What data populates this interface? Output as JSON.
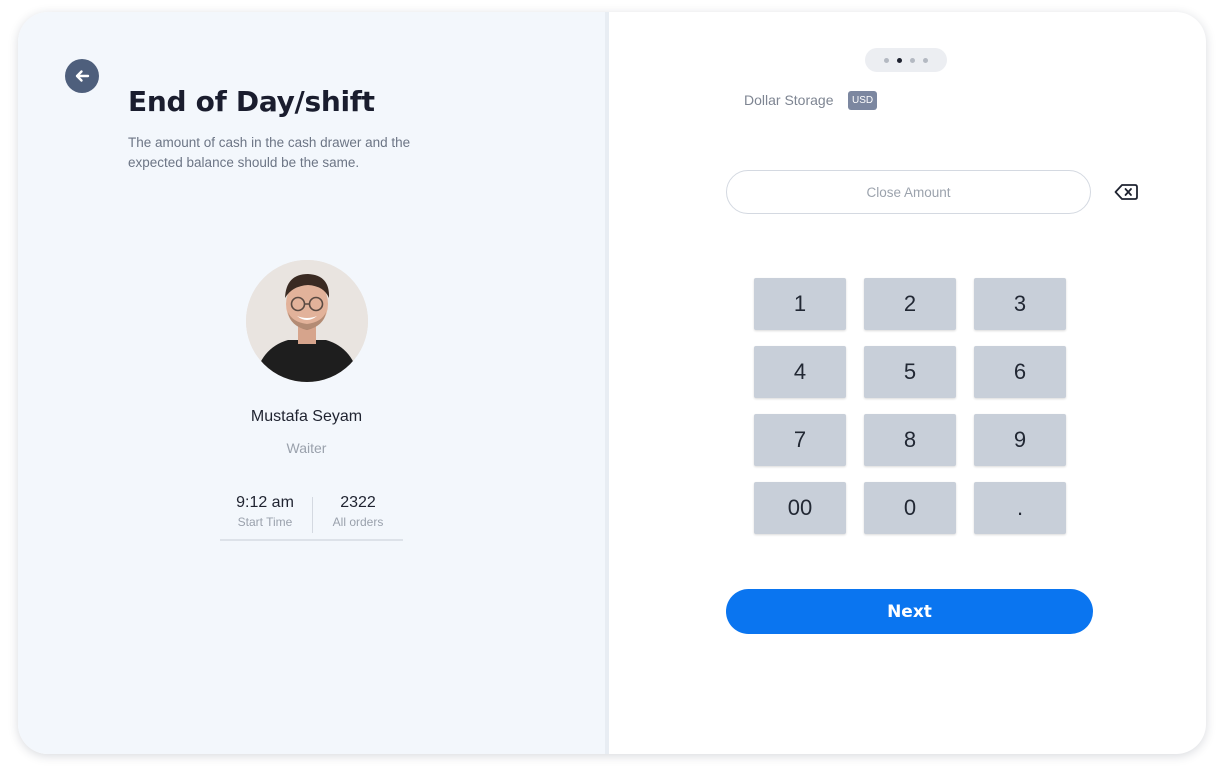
{
  "header": {
    "title": "End of Day/shift",
    "subtitle": "The amount of cash in the cash drawer and the expected balance should be the same."
  },
  "user": {
    "name": "Mustafa Seyam",
    "role": "Waiter",
    "stats": [
      {
        "value": "9:12 am",
        "label": "Start Time"
      },
      {
        "value": "2322",
        "label": "All orders"
      }
    ]
  },
  "pager": {
    "total": 4,
    "active": 2
  },
  "storage": {
    "label": "Dollar Storage",
    "currency": "USD"
  },
  "amount": {
    "placeholder": "Close Amount",
    "value": ""
  },
  "keypad": {
    "keys": [
      "1",
      "2",
      "3",
      "4",
      "5",
      "6",
      "7",
      "8",
      "9",
      "00",
      "0",
      "."
    ]
  },
  "actions": {
    "next_label": "Next"
  },
  "colors": {
    "accent": "#0a75f0",
    "left_panel": "#f3f7fc",
    "key_bg": "#c8cfd9",
    "back_button": "#4e5f7c"
  },
  "icons": {
    "back": "arrow-left-icon",
    "backspace": "backspace-icon"
  }
}
